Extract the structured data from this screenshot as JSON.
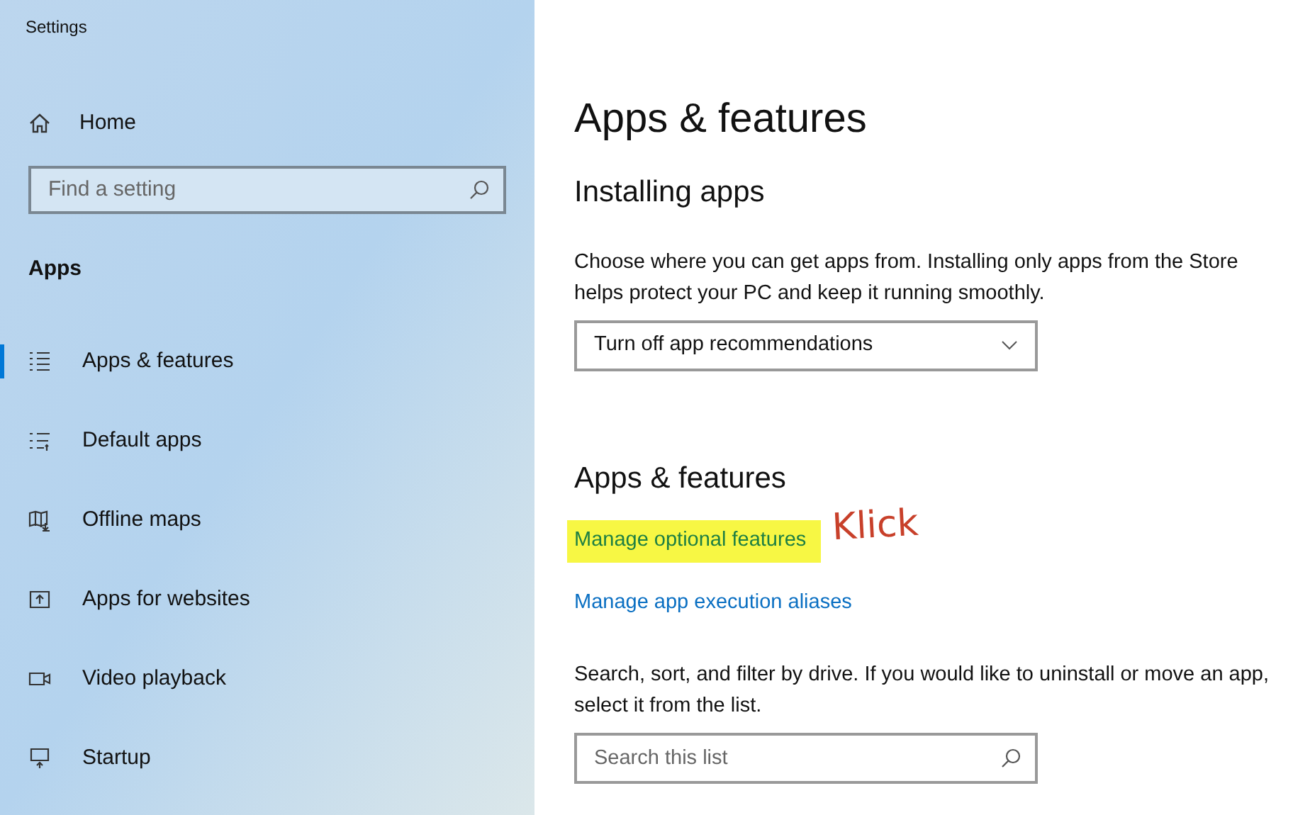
{
  "window": {
    "title": "Settings"
  },
  "sidebar": {
    "home": "Home",
    "search": {
      "placeholder": "Find a setting"
    },
    "section": "Apps",
    "items": [
      {
        "label": "Apps & features",
        "kind": "list",
        "selected": true
      },
      {
        "label": "Default apps",
        "kind": "default",
        "selected": false
      },
      {
        "label": "Offline maps",
        "kind": "map",
        "selected": false
      },
      {
        "label": "Apps for websites",
        "kind": "web",
        "selected": false
      },
      {
        "label": "Video playback",
        "kind": "video",
        "selected": false
      },
      {
        "label": "Startup",
        "kind": "startup",
        "selected": false
      }
    ]
  },
  "main": {
    "title": "Apps & features",
    "installing": {
      "heading": "Installing apps",
      "text": "Choose where you can get apps from. Installing only apps from the Store helps protect your PC and keep it running smoothly.",
      "dropdown": "Turn off app recommendations"
    },
    "features": {
      "heading": "Apps & features",
      "links": [
        {
          "label": "Manage optional features",
          "highlighted": true
        },
        {
          "label": "Manage app execution aliases",
          "highlighted": false
        }
      ],
      "text": "Search, sort, and filter by drive. If you would like to uninstall or move an app, select it from the list.",
      "search": {
        "placeholder": "Search this list"
      }
    }
  },
  "annotation": "Klick"
}
